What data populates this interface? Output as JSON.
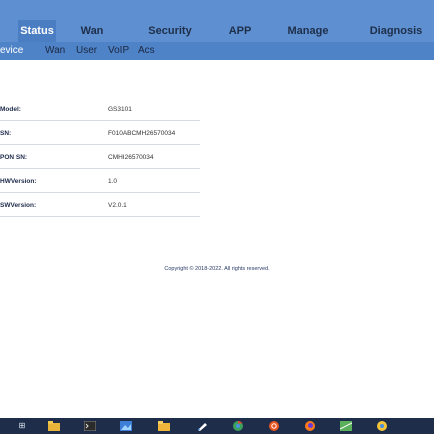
{
  "nav": {
    "tabs": [
      "Status",
      "Wan",
      "Security",
      "APP",
      "Manage",
      "Diagnosis"
    ],
    "active_tab": "Status"
  },
  "subnav": {
    "items": [
      "Device",
      "Wan",
      "User",
      "VoIP",
      "Acs"
    ],
    "visible_text": [
      "evice",
      "Wan",
      "User",
      "VoIP",
      "Acs"
    ]
  },
  "info": [
    {
      "label": "Model:",
      "visible_label": "Model:",
      "value": "GS3101"
    },
    {
      "label": "SN:",
      "visible_label": "SN:",
      "value": "F010ABCMH26570034"
    },
    {
      "label": "GPON SN:",
      "visible_label": "PON SN:",
      "value": "CMHI26570034"
    },
    {
      "label": "HWVersion:",
      "visible_label": "HWVersion:",
      "value": "1.0"
    },
    {
      "label": "SWVersion:",
      "visible_label": "SWVersion:",
      "value": "V2.0.1"
    }
  ],
  "footer": {
    "copyright": "Copyright © 2018-2022. All rights reserved."
  },
  "colors": {
    "nav_bg": "#5e8fd0",
    "active_tab_bg": "#4b7dc2",
    "subnav_bg": "#4f83c8",
    "taskbar_bg": "#1d2d4a"
  },
  "taskbar": {
    "icons": [
      "windows-icon",
      "file-explorer-icon",
      "terminal-icon",
      "image-viewer-icon",
      "folder-icon",
      "pen-icon",
      "chrome-icon",
      "ubuntu-icon",
      "firefox-icon",
      "maps-icon",
      "chrome-extra-icon"
    ]
  }
}
